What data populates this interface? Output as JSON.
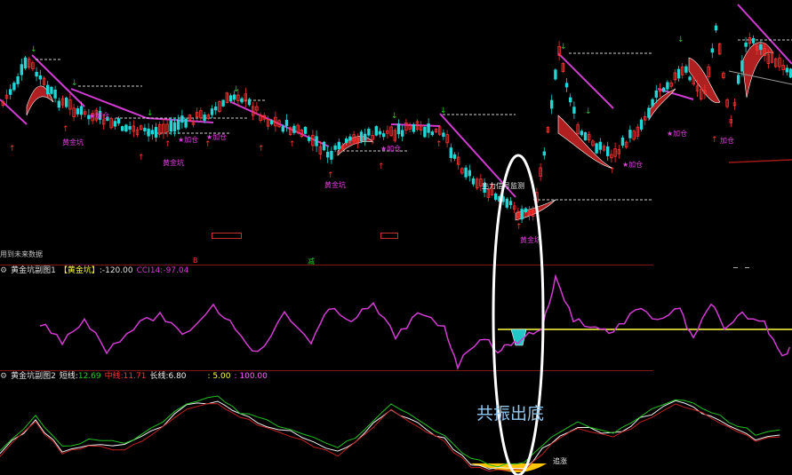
{
  "colors": {
    "up": "#ff3232",
    "down": "#22d6d6",
    "magenta": "#d23cd2",
    "yellow": "#ffff40",
    "green": "#20d020",
    "white": "#f0f0f0",
    "gold": "#ffc400",
    "darkred": "#a01818"
  },
  "main": {
    "future_data_label": "用到未来数据",
    "signal_monitor_label": "主力信号监测",
    "jinkeng_label": "黄金坑",
    "jiacang_label": "★加仓",
    "jiacang_short": "加仓",
    "separator_b": "B",
    "separator_s": "减"
  },
  "sub1": {
    "icon": "gear-icon",
    "title": "黄金坑副图1",
    "tag": "【黄金坑】",
    "tag_value": ":-120.00",
    "cci_label": "CCI14:",
    "cci_value": "-97.04"
  },
  "sub2": {
    "icon": "gear-icon",
    "title": "黄金坑副图2",
    "short_label": "短线:",
    "short_value": "12.69",
    "mid_label": "中线:",
    "mid_value": "11.71",
    "long_label": "长线:",
    "long_value": "6.80",
    "v1": ": 5.00",
    "v2": ": 100.00",
    "pursue_label": "追涨"
  },
  "annotation": {
    "text": "共振出底"
  }
}
